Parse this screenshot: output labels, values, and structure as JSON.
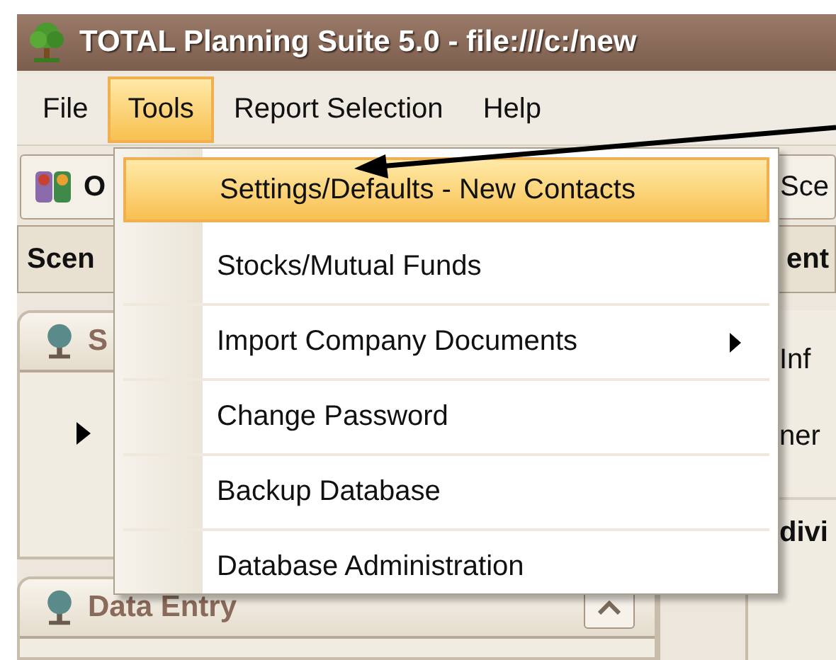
{
  "window": {
    "title": "TOTAL Planning Suite 5.0 - file:///c:/new"
  },
  "menu_bar": [
    {
      "label": "File",
      "selected": false
    },
    {
      "label": "Tools",
      "selected": true
    },
    {
      "label": "Report Selection",
      "selected": false
    },
    {
      "label": "Help",
      "selected": false
    }
  ],
  "toolbar": {
    "label": "O",
    "right_text": "Sce"
  },
  "tab_row": {
    "left": "Scen",
    "right": "ent"
  },
  "panels": [
    {
      "title": "S"
    },
    {
      "title": "Data Entry"
    }
  ],
  "right_panel": {
    "lines": [
      "Inf",
      "ner"
    ],
    "heading": "divi"
  },
  "dropdown": {
    "items": [
      {
        "label": "Settings/Defaults - New Contacts",
        "selected": true,
        "submenu": false
      },
      {
        "label": "Stocks/Mutual Funds",
        "selected": false,
        "submenu": false
      },
      {
        "label": "Import Company Documents",
        "selected": false,
        "submenu": true
      },
      {
        "label": "Change Password",
        "selected": false,
        "submenu": false
      },
      {
        "label": "Backup Database",
        "selected": false,
        "submenu": false
      },
      {
        "label": "Database Administration",
        "selected": false,
        "submenu": false
      }
    ]
  }
}
